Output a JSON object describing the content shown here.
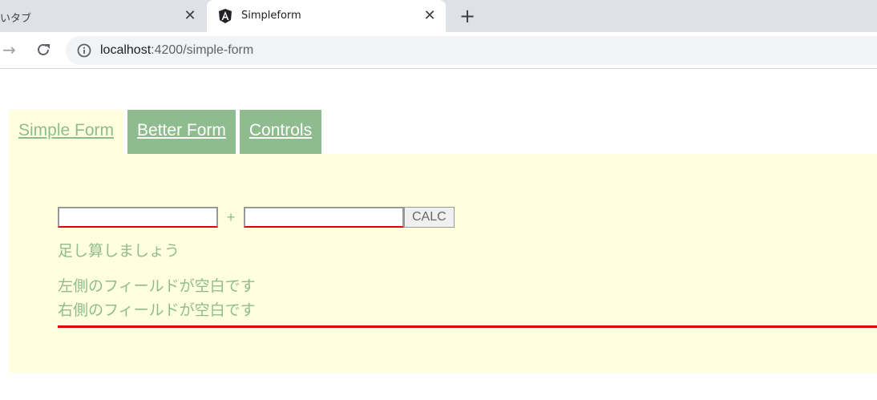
{
  "browser": {
    "tabs": [
      {
        "title": "いタブ",
        "active": false
      },
      {
        "title": "Simpleform",
        "active": true
      }
    ],
    "close_glyph": "✕",
    "new_tab_glyph": "+",
    "url_host": "localhost",
    "url_path": ":4200/simple-form"
  },
  "nav": {
    "items": [
      {
        "label": "Simple Form ",
        "active": true
      },
      {
        "label": "Better Form ",
        "active": false
      },
      {
        "label": "Controls",
        "active": false
      }
    ]
  },
  "form": {
    "left_value": "",
    "plus": "+",
    "right_value": "",
    "calc_label": "CALC",
    "hint": "足し算しましょう",
    "errors": [
      "左側のフィールドが空白です",
      "右側のフィールドが空白です"
    ]
  },
  "colors": {
    "accent": "#8fbc8f",
    "panel_bg": "#ffffdf",
    "error": "#e00000"
  }
}
